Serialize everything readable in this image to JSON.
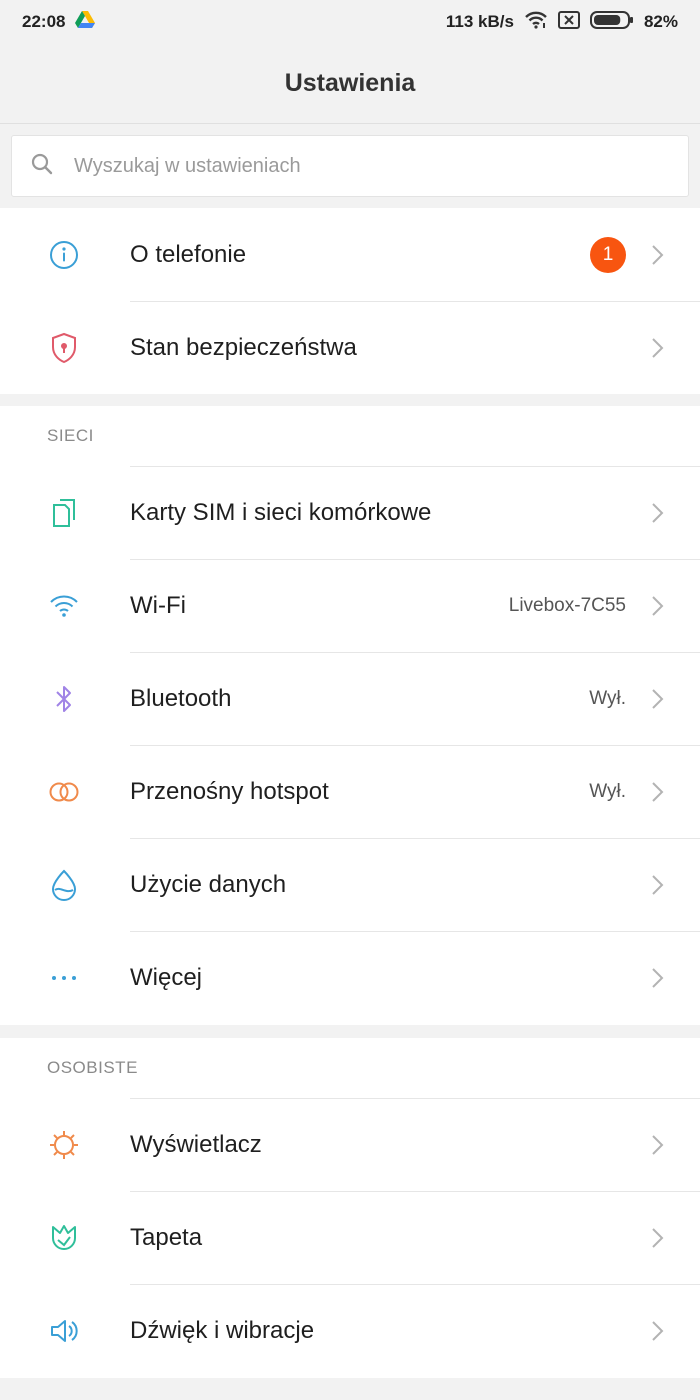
{
  "status_bar": {
    "time": "22:08",
    "speed": "113 kB/s",
    "battery": "82%",
    "battery_level": 0.82,
    "icons": [
      "drive-icon",
      "wifi-icon",
      "no-sim-icon",
      "battery-icon"
    ]
  },
  "title": "Ustawienia",
  "search": {
    "placeholder": "Wyszukaj w ustawieniach"
  },
  "top_items": [
    {
      "label": "O telefonie",
      "badge": "1",
      "icon": "info-icon"
    },
    {
      "label": "Stan bezpieczeństwa",
      "icon": "shield-icon"
    }
  ],
  "sections": [
    {
      "header": "SIECI",
      "items": [
        {
          "label": "Karty SIM i sieci komórkowe",
          "icon": "sim-icon"
        },
        {
          "label": "Wi-Fi",
          "value": "Livebox-7C55",
          "icon": "wifi-icon"
        },
        {
          "label": "Bluetooth",
          "value": "Wył.",
          "icon": "bluetooth-icon"
        },
        {
          "label": "Przenośny hotspot",
          "value": "Wył.",
          "icon": "hotspot-icon"
        },
        {
          "label": "Użycie danych",
          "icon": "data-drop-icon"
        },
        {
          "label": "Więcej",
          "icon": "more-dots-icon"
        }
      ]
    },
    {
      "header": "OSOBISTE",
      "items": [
        {
          "label": "Wyświetlacz",
          "icon": "sun-icon"
        },
        {
          "label": "Tapeta",
          "icon": "tulip-icon"
        },
        {
          "label": "Dźwięk i wibracje",
          "icon": "speaker-icon"
        }
      ]
    }
  ],
  "colors": {
    "badge": "#f85510",
    "info_icon": "#3a9fd6",
    "shield_icon": "#e05a6a",
    "sim_icon": "#2fbf9a",
    "wifi_icon": "#3a9fd6",
    "bluetooth_icon": "#a083e6",
    "hotspot_icon": "#f08a4b",
    "data_icon": "#3a9fd6",
    "more_icon": "#3a9fd6",
    "display_icon": "#f08a4b",
    "wallpaper_icon": "#2fbf9a",
    "sound_icon": "#3a9fd6"
  }
}
